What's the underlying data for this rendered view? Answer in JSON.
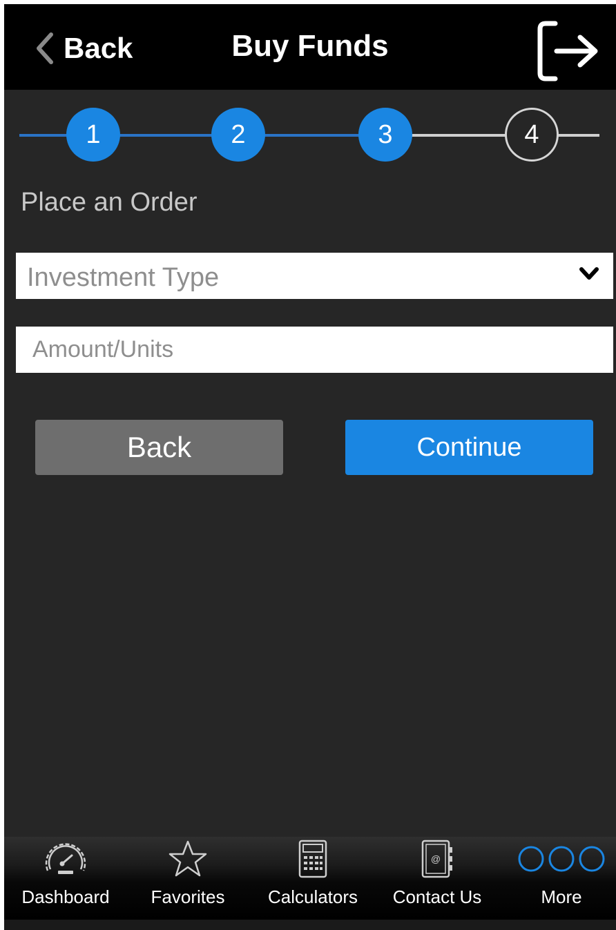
{
  "header": {
    "back_label": "Back",
    "title": "Buy Funds"
  },
  "stepper": {
    "current_step": 3,
    "steps": [
      "1",
      "2",
      "3",
      "4"
    ],
    "active_color": "#1a86e2"
  },
  "form": {
    "section_title": "Place an Order",
    "investment_type_placeholder": "Investment Type",
    "amount_placeholder": "Amount/Units",
    "back_button": "Back",
    "continue_button": "Continue"
  },
  "tabbar": {
    "items": [
      {
        "label": "Dashboard",
        "icon": "speedometer-icon"
      },
      {
        "label": "Favorites",
        "icon": "star-icon"
      },
      {
        "label": "Calculators",
        "icon": "calculator-icon"
      },
      {
        "label": "Contact Us",
        "icon": "contact-book-icon"
      },
      {
        "label": "More",
        "icon": "more-icon"
      }
    ]
  },
  "colors": {
    "accent": "#1a86e2",
    "background": "#262626",
    "header": "#000000",
    "secondary_button": "#6e6e6e"
  }
}
